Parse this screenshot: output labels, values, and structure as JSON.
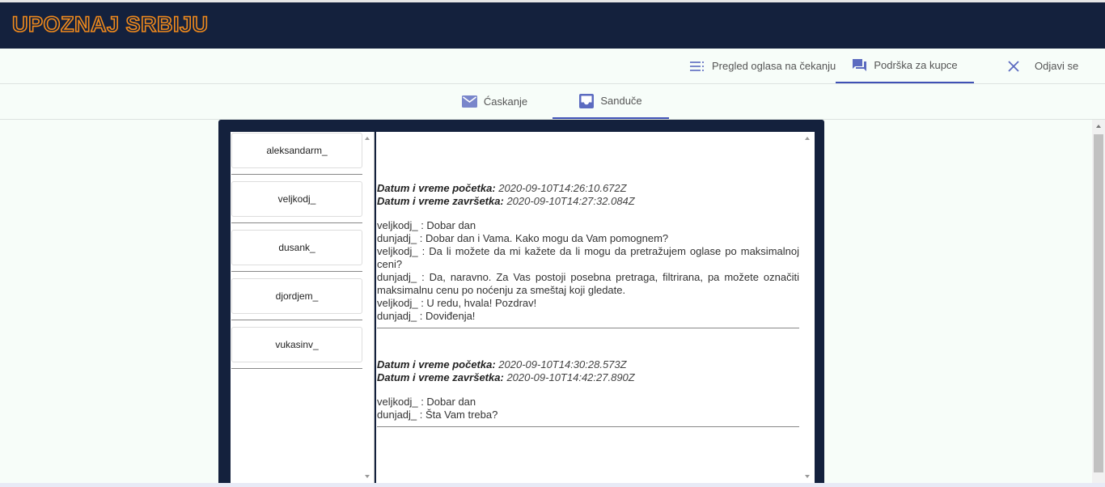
{
  "app": {
    "logo": "UPOZNAJ SRBIJU"
  },
  "nav": {
    "pending": "Pregled oglasa na čekanju",
    "support": "Podrška za kupce",
    "logout": "Odjavi se"
  },
  "tabs": {
    "chat": "Ćaskanje",
    "inbox": "Sanduče"
  },
  "users": [
    "aleksandarm_",
    "veljkodj_",
    "dusank_",
    "djordjem_",
    "vukasinv_"
  ],
  "conversations": [
    {
      "start_label": "Datum i vreme početka:",
      "start": "2020-09-10T14:26:10.672Z",
      "end_label": "Datum i vreme završetka:",
      "end": "2020-09-10T14:27:32.084Z",
      "messages": [
        "veljkodj_ : Dobar dan",
        "dunjadj_ : Dobar dan i Vama. Kako mogu da Vam pomognem?",
        "veljkodj_ : Da li možete da mi kažete da li mogu da pretražujem oglase po maksimalnoj ceni?",
        "dunjadj_ : Da, naravno. Za Vas postoji posebna pretraga, filtrirana, pa možete označiti maksimalnu cenu po noćenju za smeštaj koji gledate.",
        "veljkodj_ : U redu, hvala! Pozdrav!",
        "dunjadj_ : Doviđenja!"
      ]
    },
    {
      "start_label": "Datum i vreme početka:",
      "start": "2020-09-10T14:30:28.573Z",
      "end_label": "Datum i vreme završetka:",
      "end": "2020-09-10T14:42:27.890Z",
      "messages": [
        "veljkodj_ : Dobar dan",
        "dunjadj_ : Šta Vam treba?"
      ]
    }
  ],
  "colors": {
    "header_bg": "#14213d",
    "logo": "#f08a1c",
    "accent": "#3f51b5",
    "icon": "#5c6bc0"
  },
  "icons": {
    "pending": "list-icon",
    "support": "forum-icon",
    "logout": "close-icon",
    "chat": "mail-icon",
    "inbox": "inbox-icon"
  }
}
